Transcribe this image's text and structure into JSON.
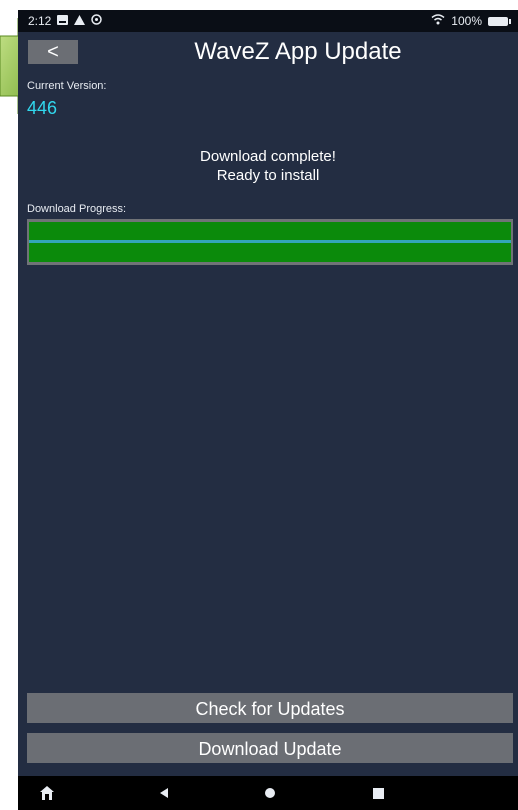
{
  "status_bar": {
    "time": "2:12",
    "battery": "100%"
  },
  "header": {
    "back_label": "<",
    "title": "WaveZ App Update"
  },
  "current_version": {
    "label": "Current Version:",
    "value": "446"
  },
  "status": {
    "line1": "Download complete!",
    "line2": "Ready to install"
  },
  "download_progress": {
    "label": "Download Progress:",
    "fraction": 1.0
  },
  "buttons": {
    "check_updates": "Check for Updates",
    "download_update": "Download Update"
  },
  "colors": {
    "background": "#232d42",
    "accent_text": "#31d8ee",
    "progress_fill": "#0b8a0b",
    "button": "#6b6e74",
    "pointer": "#8bc34a"
  },
  "icons": [
    "image-icon",
    "alert-icon",
    "settings-icon",
    "wifi-icon",
    "battery-icon",
    "home-icon",
    "back-icon",
    "circle-home-icon",
    "recents-icon"
  ]
}
